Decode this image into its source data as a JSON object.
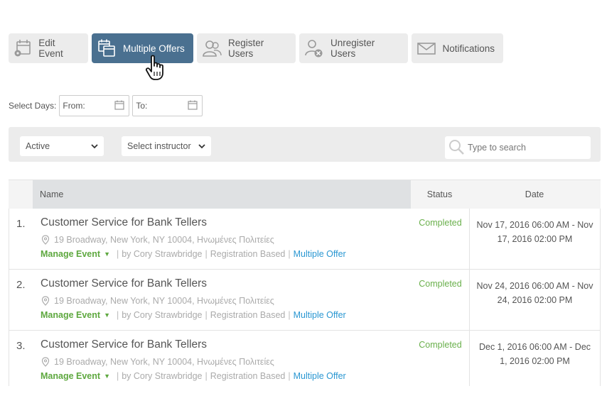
{
  "toolbar": {
    "edit_event": "Edit Event",
    "multiple_offers": "Multiple Offers",
    "register_users": "Register Users",
    "unregister_users": "Unregister Users",
    "notifications": "Notifications"
  },
  "date_filter": {
    "label": "Select Days:",
    "from_placeholder": "From:",
    "to_placeholder": "To:"
  },
  "filters": {
    "status_value": "Active",
    "instructor_value": "Select instructor",
    "search_placeholder": "Type to search"
  },
  "table": {
    "headers": {
      "name": "Name",
      "status": "Status",
      "date": "Date"
    },
    "rows": [
      {
        "num": "1.",
        "title": "Customer Service for Bank Tellers",
        "address": "19 Broadway, New York, NY 10004, Ηνωμένες Πολιτείες",
        "manage": "Manage Event",
        "by": "by Cory Strawbridge",
        "type": "Registration Based",
        "multi": "Multiple Offer",
        "status": "Completed",
        "date": "Nov 17, 2016 06:00 AM - Nov 17, 2016 02:00 PM"
      },
      {
        "num": "2.",
        "title": "Customer Service for Bank Tellers",
        "address": "19 Broadway, New York, NY 10004, Ηνωμένες Πολιτείες",
        "manage": "Manage Event",
        "by": "by Cory Strawbridge",
        "type": "Registration Based",
        "multi": "Multiple Offer",
        "status": "Completed",
        "date": "Nov 24, 2016 06:00 AM - Nov 24, 2016 02:00 PM"
      },
      {
        "num": "3.",
        "title": "Customer Service for Bank Tellers",
        "address": "19 Broadway, New York, NY 10004, Ηνωμένες Πολιτείες",
        "manage": "Manage Event",
        "by": "by Cory Strawbridge",
        "type": "Registration Based",
        "multi": "Multiple Offer",
        "status": "Completed",
        "date": "Dec 1, 2016 06:00 AM - Dec 1, 2016 02:00 PM"
      }
    ]
  },
  "colors": {
    "active_button": "#4a7090",
    "completed": "#6ab04c",
    "manage_link": "#5ea83f",
    "multi_link": "#2a97d2"
  },
  "icons": {
    "edit_event": "calendar-gear-icon",
    "multiple_offers": "calendars-icon",
    "register_users": "users-icon",
    "unregister_users": "user-remove-icon",
    "notifications": "envelope-icon",
    "search": "search-icon",
    "date": "calendar-icon",
    "address": "map-pin-icon",
    "cursor": "hand-pointer-icon"
  }
}
